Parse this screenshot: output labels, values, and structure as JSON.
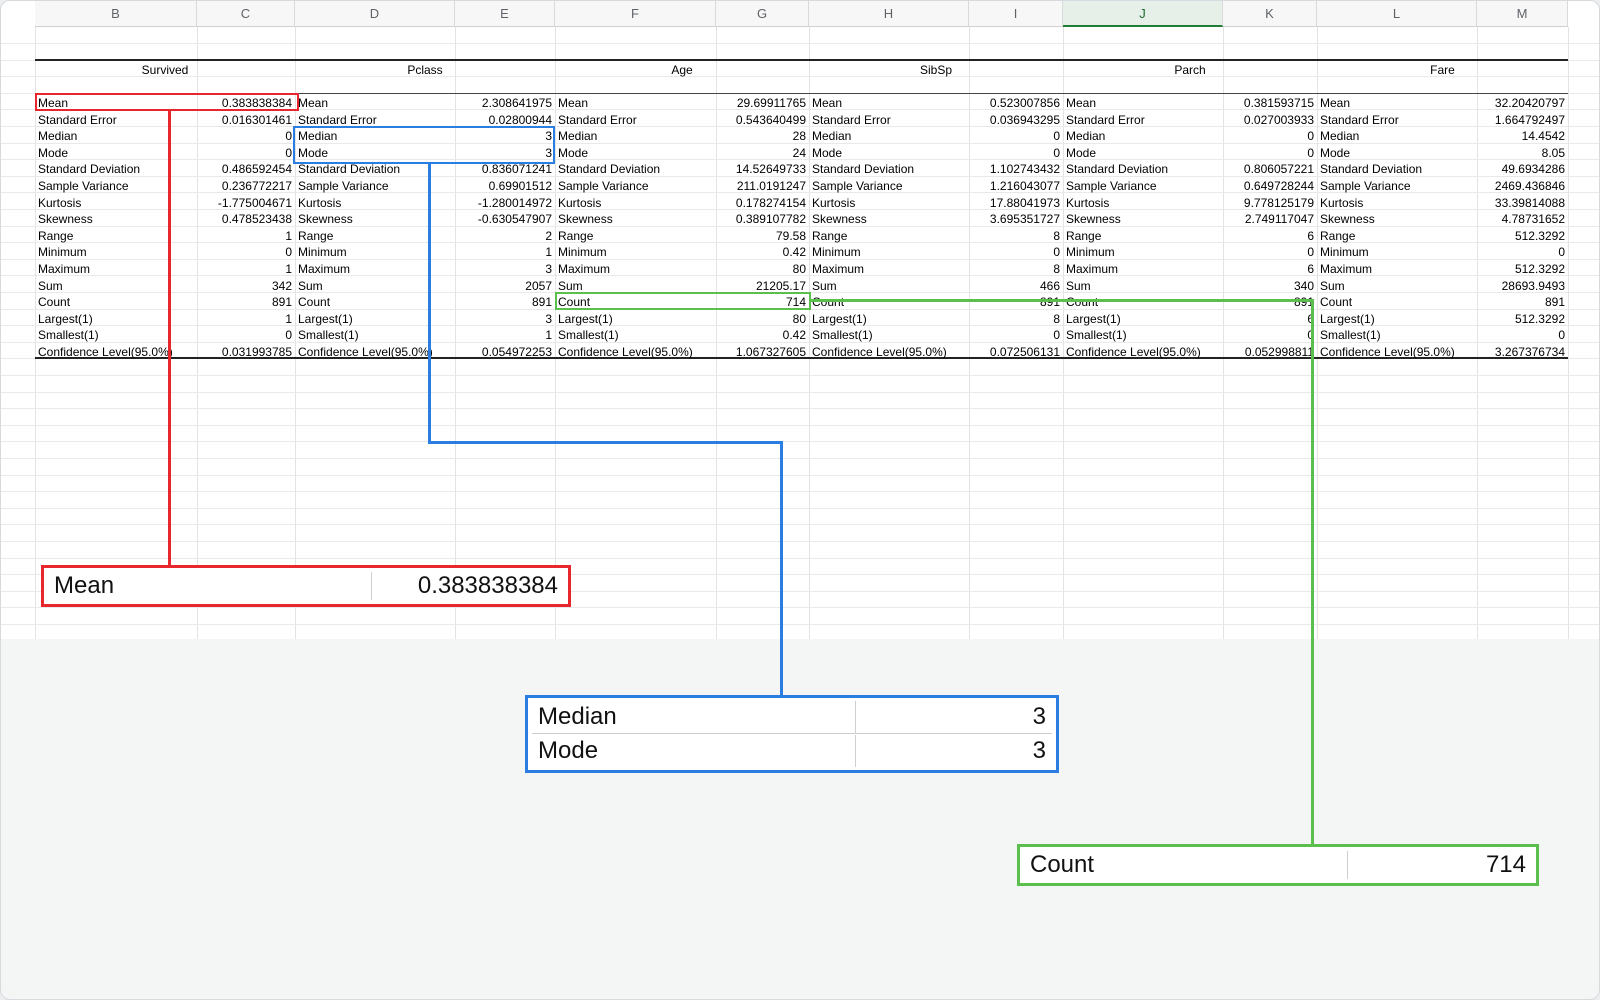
{
  "columns": [
    "B",
    "C",
    "D",
    "E",
    "F",
    "G",
    "H",
    "I",
    "J",
    "K",
    "L",
    "M"
  ],
  "active_column": "J",
  "variables": [
    {
      "name": "Survived",
      "values": [
        "0.383838384",
        "0.016301461",
        "0",
        "0",
        "0.486592454",
        "0.236772217",
        "-1.775004671",
        "0.478523438",
        "1",
        "0",
        "1",
        "342",
        "891",
        "1",
        "0",
        "0.031993785"
      ]
    },
    {
      "name": "Pclass",
      "values": [
        "2.308641975",
        "0.02800944",
        "3",
        "3",
        "0.836071241",
        "0.69901512",
        "-1.280014972",
        "-0.630547907",
        "2",
        "1",
        "3",
        "2057",
        "891",
        "3",
        "1",
        "0.054972253"
      ]
    },
    {
      "name": "Age",
      "values": [
        "29.69911765",
        "0.543640499",
        "28",
        "24",
        "14.52649733",
        "211.0191247",
        "0.178274154",
        "0.389107782",
        "79.58",
        "0.42",
        "80",
        "21205.17",
        "714",
        "80",
        "0.42",
        "1.067327605"
      ]
    },
    {
      "name": "SibSp",
      "values": [
        "0.523007856",
        "0.036943295",
        "0",
        "0",
        "1.102743432",
        "1.216043077",
        "17.88041973",
        "3.695351727",
        "8",
        "0",
        "8",
        "466",
        "891",
        "8",
        "0",
        "0.072506131"
      ]
    },
    {
      "name": "Parch",
      "values": [
        "0.381593715",
        "0.027003933",
        "0",
        "0",
        "0.806057221",
        "0.649728244",
        "9.778125179",
        "2.749117047",
        "6",
        "0",
        "6",
        "340",
        "891",
        "6",
        "0",
        "0.052998811"
      ]
    },
    {
      "name": "Fare",
      "values": [
        "32.20420797",
        "1.664792497",
        "14.4542",
        "8.05",
        "49.6934286",
        "2469.436846",
        "33.39814088",
        "4.78731652",
        "512.3292",
        "0",
        "512.3292",
        "28693.9493",
        "891",
        "512.3292",
        "0",
        "3.267376734"
      ]
    }
  ],
  "stat_labels": [
    "Mean",
    "Standard Error",
    "Median",
    "Mode",
    "Standard Deviation",
    "Sample Variance",
    "Kurtosis",
    "Skewness",
    "Range",
    "Minimum",
    "Maximum",
    "Sum",
    "Count",
    "Largest(1)",
    "Smallest(1)",
    "Confidence Level(95.0%)"
  ],
  "callouts": {
    "mean": {
      "label": "Mean",
      "value": "0.383838384",
      "color": "#e8262d"
    },
    "median": {
      "label": "Median",
      "value": "3",
      "color": "#2a7de1"
    },
    "mode": {
      "label": "Mode",
      "value": "3",
      "color": "#2a7de1"
    },
    "count": {
      "label": "Count",
      "value": "714",
      "color": "#5bbf4e"
    }
  }
}
